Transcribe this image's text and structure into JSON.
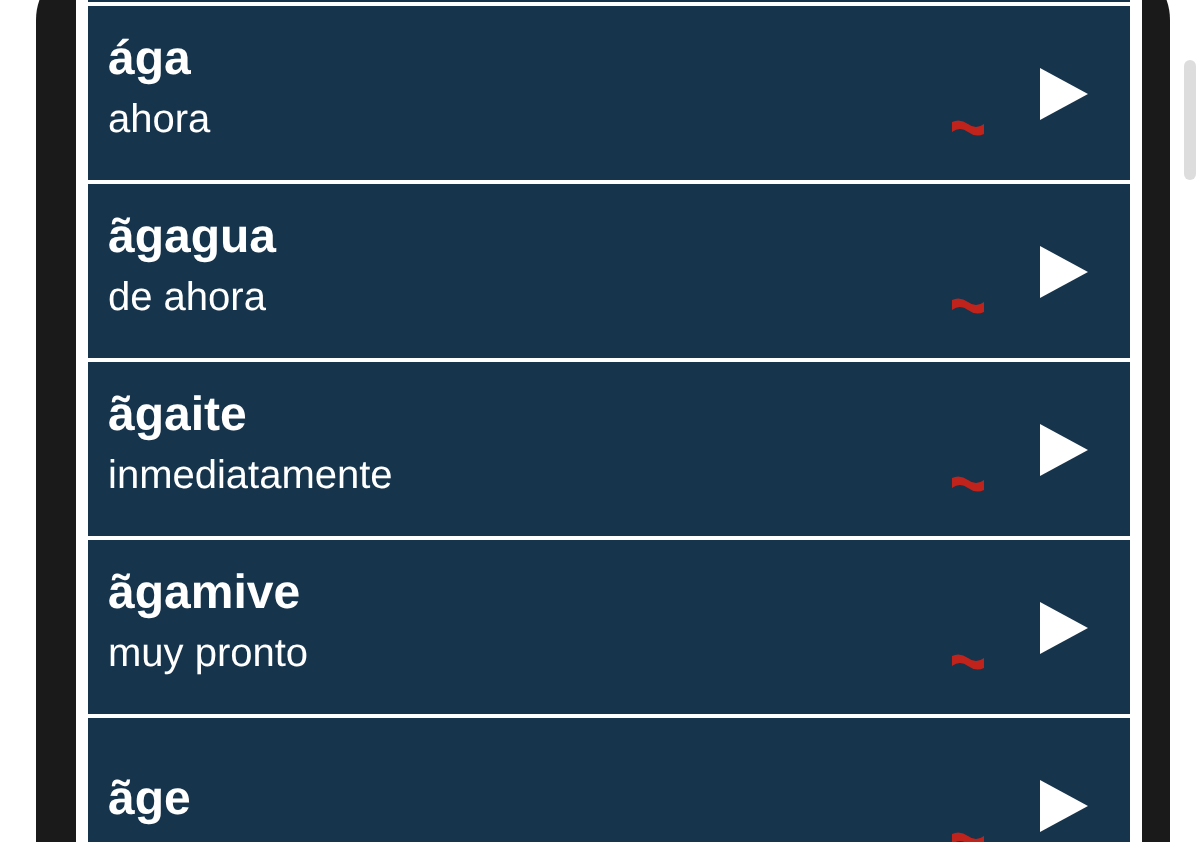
{
  "entries": [
    {
      "word": "ága",
      "translation": "ahora"
    },
    {
      "word": "ãgagua",
      "translation": "de ahora"
    },
    {
      "word": "ãgaite",
      "translation": "inmediatamente"
    },
    {
      "word": "ãgamive",
      "translation": "muy pronto"
    },
    {
      "word": "ãge"
    }
  ]
}
